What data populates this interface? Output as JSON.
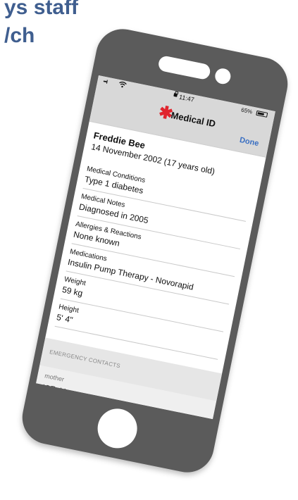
{
  "background": {
    "heading_line1": "ys staff",
    "heading_line2": "/ch",
    "heading_color": "#3f5e8f"
  },
  "status_bar": {
    "signal": "•••ll",
    "wifi_icon": "wifi-icon",
    "lock_icon": "lock-icon",
    "time": "11:47",
    "battery_percent": "65%",
    "battery_icon": "battery-icon"
  },
  "nav": {
    "star_symbol": "✱",
    "star_color": "#e0242d",
    "title": "Medical ID",
    "done_label": "Done",
    "done_color": "#3a6fc2"
  },
  "person": {
    "name": "Freddie Bee",
    "dob": "14 November 2002 (17 years old)"
  },
  "fields": [
    {
      "label": "Medical Conditions",
      "value": "Type 1 diabetes"
    },
    {
      "label": "Medical Notes",
      "value": "Diagnosed in 2005"
    },
    {
      "label": "Allergies & Reactions",
      "value": "None known"
    },
    {
      "label": "Medications",
      "value": "Insulin Pump Therapy - Novorapid"
    },
    {
      "label": "Weight",
      "value": "59 kg"
    },
    {
      "label": "Height",
      "value": "5' 4\""
    }
  ],
  "emergency_contacts": {
    "header": "EMERGENCY CONTACTS",
    "contacts": [
      {
        "relation": "mother",
        "name": "ICE: Mam"
      }
    ]
  },
  "phone": {
    "body_color": "#5b5b5b"
  }
}
